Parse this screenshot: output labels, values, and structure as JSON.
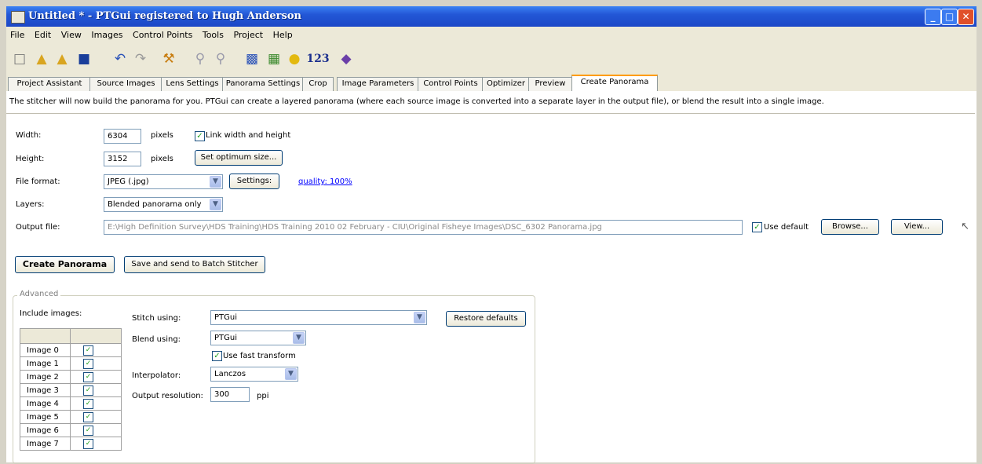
{
  "window": {
    "title": "Untitled * - PTGui registered to Hugh Anderson",
    "min_glyph": "_",
    "max_glyph": "□",
    "close_glyph": "✕"
  },
  "menu": [
    "File",
    "Edit",
    "View",
    "Images",
    "Control Points",
    "Tools",
    "Project",
    "Help"
  ],
  "toolbar": {
    "icons": [
      "new-document-icon",
      "open-folder-icon",
      "open-recent-icon",
      "save-icon",
      "undo-icon",
      "redo-icon",
      "tools-icon",
      "zoom-in-icon",
      "zoom-out-icon",
      "panorama-editor-icon",
      "table-icon",
      "hint-bulb-icon",
      "numbering-icon",
      "ptgui-logo-icon"
    ],
    "numbers_label": "123"
  },
  "tabs": [
    "Project Assistant",
    "Source Images",
    "Lens Settings",
    "Panorama Settings",
    "Crop",
    "Image Parameters",
    "Control Points",
    "Optimizer",
    "Preview",
    "Create Panorama"
  ],
  "active_tab": "Create Panorama",
  "description": "The stitcher will now build the panorama for you. PTGui can create a layered panorama (where each source image is converted into a separate layer in the output file), or blend the result into a single image.",
  "form": {
    "width_label": "Width:",
    "width_value": "6304",
    "width_unit": "pixels",
    "link_label": "Link width and height",
    "height_label": "Height:",
    "height_value": "3152",
    "height_unit": "pixels",
    "optimum_button": "Set optimum size...",
    "format_label": "File format:",
    "format_value": "JPEG (.jpg)",
    "settings_button": "Settings:",
    "quality_link": "quality: 100%",
    "layers_label": "Layers:",
    "layers_value": "Blended panorama only",
    "output_label": "Output file:",
    "output_path": "E:\\High Definition Survey\\HDS Training\\HDS Training 2010 02 February - CIU\\Original Fisheye Images\\DSC_6302 Panorama.jpg",
    "use_default_label": "Use default",
    "browse_button": "Browse...",
    "view_button": "View..."
  },
  "actions": {
    "create_button": "Create Panorama",
    "batch_button": "Save and send to Batch Stitcher"
  },
  "advanced": {
    "title": "Advanced",
    "include_label": "Include images:",
    "images": [
      "Image 0",
      "Image 1",
      "Image 2",
      "Image 3",
      "Image 4",
      "Image 5",
      "Image 6",
      "Image 7"
    ],
    "stitch_label": "Stitch using:",
    "stitch_value": "PTGui",
    "restore_button": "Restore defaults",
    "blend_label": "Blend using:",
    "blend_value": "PTGui",
    "fast_transform_label": "Use fast transform",
    "interpolator_label": "Interpolator:",
    "interpolator_value": "Lanczos",
    "resolution_label": "Output resolution:",
    "resolution_value": "300",
    "resolution_unit": "ppi"
  }
}
